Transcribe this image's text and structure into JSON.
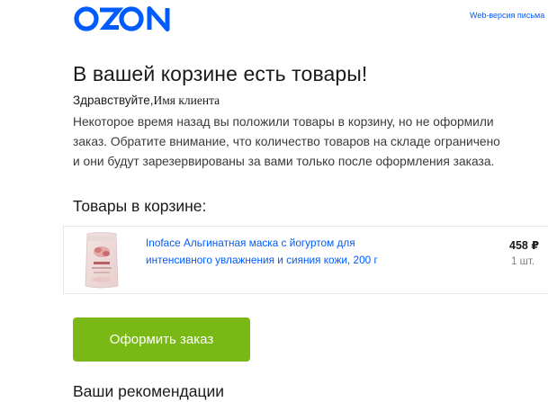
{
  "header": {
    "logo_text": "OZON",
    "web_version_link": "Web-версия письма"
  },
  "email": {
    "title": "В вашей корзине есть товары!",
    "greeting": "Здравствуйте,",
    "client_name": "Имя клиента",
    "body_lines": [
      "Некоторое время назад вы положили товары в корзину, но не оформили",
      "заказ. Обратите внимание, что количество товаров на складе ограничено",
      "и они будут зарезервированы за вами только после оформления заказа."
    ],
    "cart_heading": "Товары в корзине:",
    "recommendations_heading": "Ваши рекомендации"
  },
  "cart": {
    "items": [
      {
        "name_lines": [
          "Inoface Альгинатная маска с йогуртом для",
          "интенсивного увлажнения и сияния кожи, 200 г"
        ],
        "price": "458 ₽",
        "quantity": "1 шт.",
        "image_icon": "product-package-icon"
      }
    ]
  },
  "actions": {
    "checkout_label": "Оформить заказ"
  },
  "colors": {
    "brand_blue": "#005bff",
    "button_green": "#7ab815",
    "border": "#e6e8eb",
    "muted_text": "#808080"
  }
}
